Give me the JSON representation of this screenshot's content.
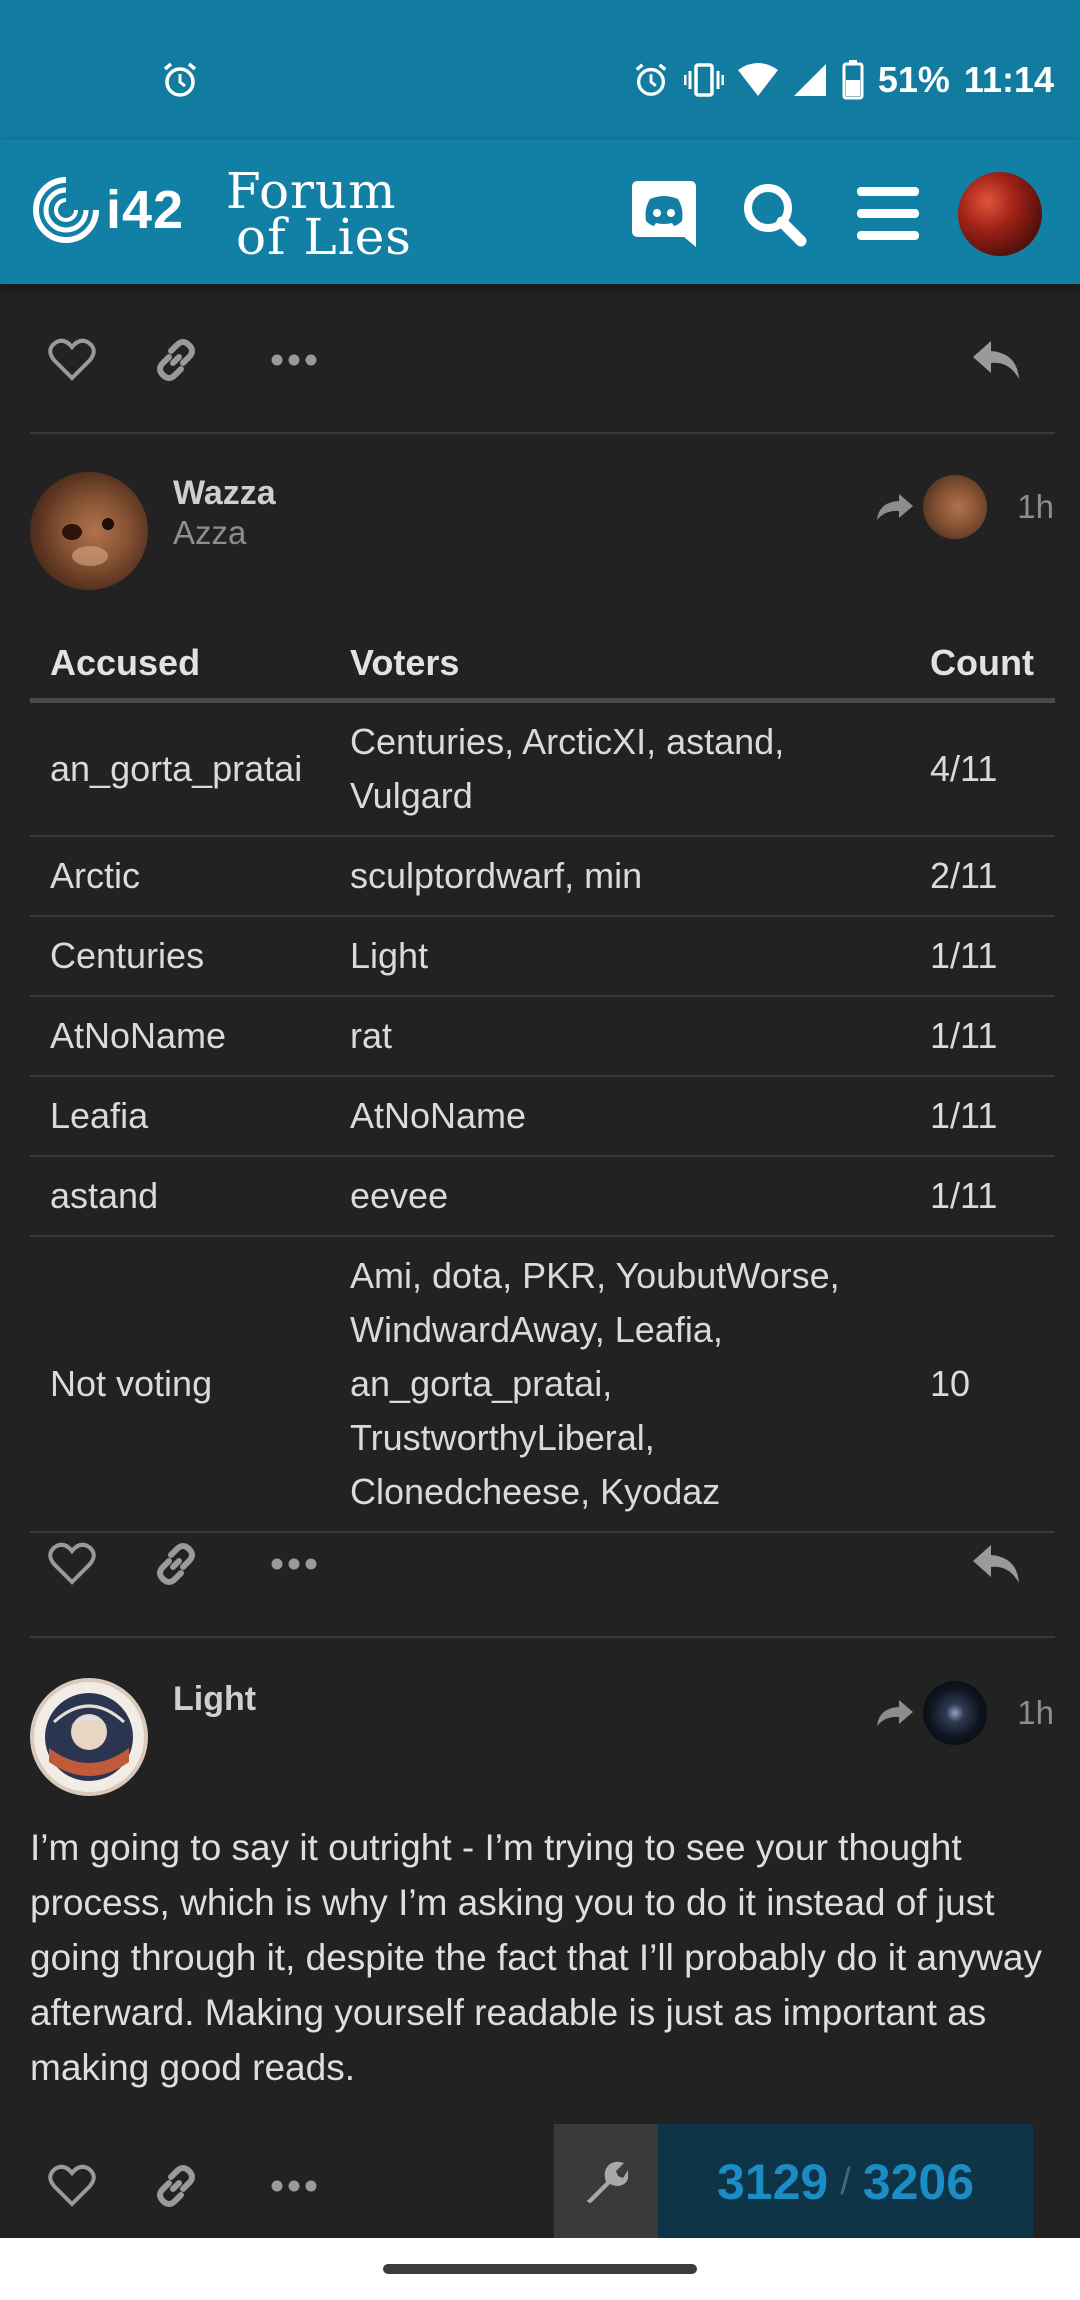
{
  "status_bar": {
    "battery": "51%",
    "time": "11:14",
    "icons": [
      "alarm-icon",
      "alarm-icon",
      "vibrate-icon",
      "wifi-icon",
      "signal-icon",
      "battery-icon"
    ]
  },
  "header": {
    "logo_text": "i42",
    "forum_logo_line1": "Forum",
    "forum_logo_line2": "of Lies",
    "icons": [
      "discord-icon",
      "search-icon",
      "hamburger-menu-icon",
      "user-avatar"
    ]
  },
  "posts": [
    {
      "username": "Wazza",
      "subtitle": "Azza",
      "time": "1h",
      "table": {
        "headers": [
          "Accused",
          "Voters",
          "Count"
        ],
        "rows": [
          [
            "an_gorta_pratai",
            "Centuries, ArcticXI, astand, Vulgard",
            "4/11"
          ],
          [
            "Arctic",
            "sculptordwarf, min",
            "2/11"
          ],
          [
            "Centuries",
            "Light",
            "1/11"
          ],
          [
            "AtNoName",
            "rat",
            "1/11"
          ],
          [
            "Leafia",
            "AtNoName",
            "1/11"
          ],
          [
            "astand",
            "eevee",
            "1/11"
          ],
          [
            "Not voting",
            "Ami, dota, PKR, YoubutWorse, WindwardAway, Leafia, an_gorta_pratai, TrustworthyLiberal, Clonedcheese, Kyodaz",
            "10"
          ]
        ]
      }
    },
    {
      "username": "Light",
      "time": "1h",
      "body": "I’m going to say it outright - I’m trying to see your thought process, which is why I’m asking you to do it instead of just going through it, despite the fact that I’ll probably do it anyway afterward. Making yourself readable is just as important as making good reads."
    }
  ],
  "progress": {
    "current": "3129",
    "separator": "/",
    "total": "3206"
  },
  "colors": {
    "header_bg": "#127fa4",
    "status_bg": "#117ca0",
    "page_bg": "#222222",
    "progress_text": "#1c8cc4"
  }
}
